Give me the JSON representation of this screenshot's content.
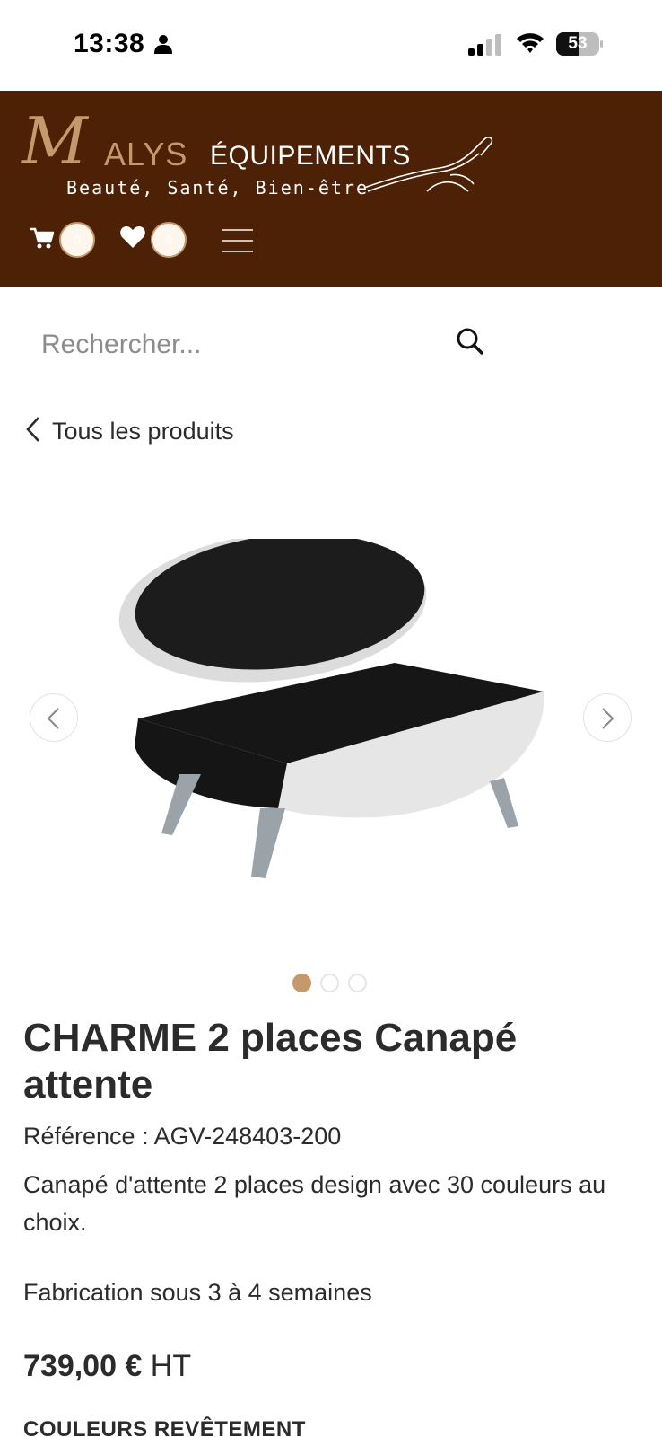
{
  "status_bar": {
    "time": "13:38",
    "battery": "53",
    "battery_level": 0.53
  },
  "header": {
    "logo": {
      "m": "M",
      "alys": "ALYS",
      "equipements": "ÉQUIPEMENTS",
      "tagline": "Beauté, Santé, Bien-être"
    },
    "cart_count": "0",
    "wishlist_count": "0",
    "colors": {
      "background": "#4c2106",
      "accent": "#c49a6c"
    }
  },
  "search": {
    "placeholder": "Rechercher...",
    "value": ""
  },
  "back_link": {
    "label": "Tous les produits"
  },
  "carousel": {
    "image_alt": "CHARME 2 places Canapé attente",
    "active_index": 0,
    "dot_count": 3
  },
  "product": {
    "title": "CHARME 2 places Canapé attente",
    "reference": "Référence : AGV-248403-200",
    "description": "Canapé d'attente 2 places design avec 30 couleurs au choix.",
    "lead_time": "Fabrication sous 3 à 4 semaines",
    "price": "739,00 €",
    "price_suffix": " HT",
    "section_label": "COULEURS REVÊTEMENT"
  }
}
